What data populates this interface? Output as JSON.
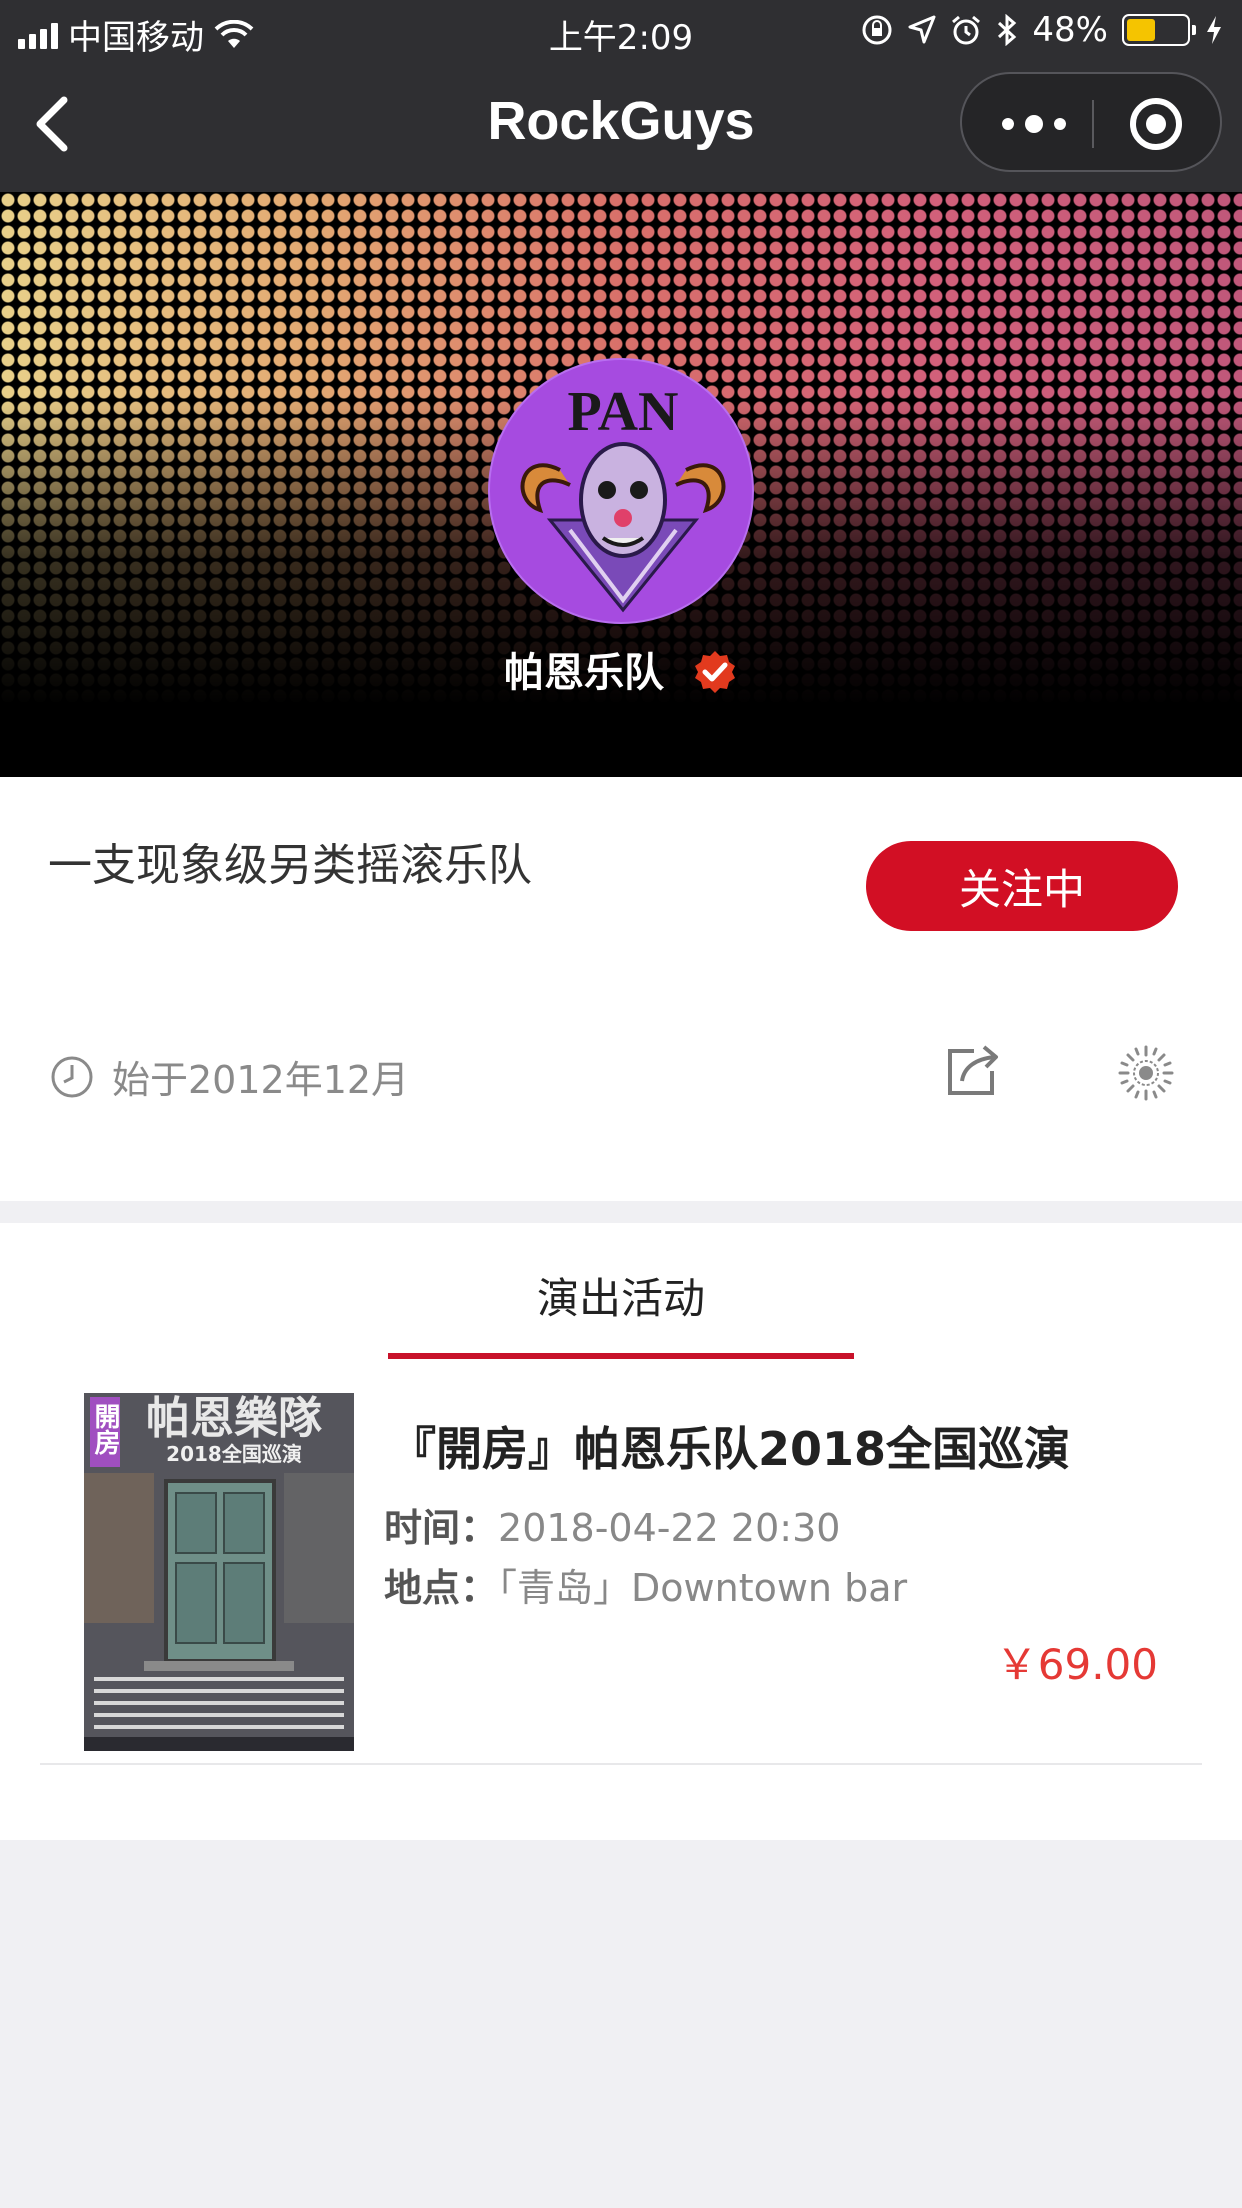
{
  "status_bar": {
    "carrier": "中国移动",
    "time": "上午2:09",
    "battery_percent": "48%",
    "battery_level": 0.48,
    "icons": [
      "signal-icon",
      "wifi-icon",
      "orientation-lock-icon",
      "location-icon",
      "alarm-icon",
      "bluetooth-icon",
      "battery-icon",
      "charging-icon"
    ]
  },
  "nav": {
    "title": "RockGuys",
    "icons": [
      "back-icon",
      "more-icon",
      "close-target-icon"
    ]
  },
  "band": {
    "name": "帕恩乐队",
    "logo_text": "PAN",
    "tagline": "一支现象级另类摇滚乐队",
    "follow_label": "关注中",
    "since": "始于2012年12月",
    "icons": [
      "verified-icon",
      "clock-icon",
      "share-icon",
      "qrcode-icon"
    ]
  },
  "events": {
    "tab_label": "演出活动",
    "items": [
      {
        "title": "『開房』帕恩乐队2018全国巡演",
        "time_label": "时间：",
        "time_value": "2018-04-22 20:30",
        "place_label": "地点：",
        "place_value": "「青岛」Downtown bar",
        "price": "￥69.00",
        "poster_title": "帕恩樂隊",
        "poster_subtitle": "2018全国巡演",
        "poster_corner": "開房"
      }
    ]
  },
  "colors": {
    "nav_bg": "#2f2f32",
    "accent_red": "#d20f24",
    "price_red": "#e53935",
    "avatar_purple": "#a64be0",
    "page_bg": "#f0f0f3"
  }
}
